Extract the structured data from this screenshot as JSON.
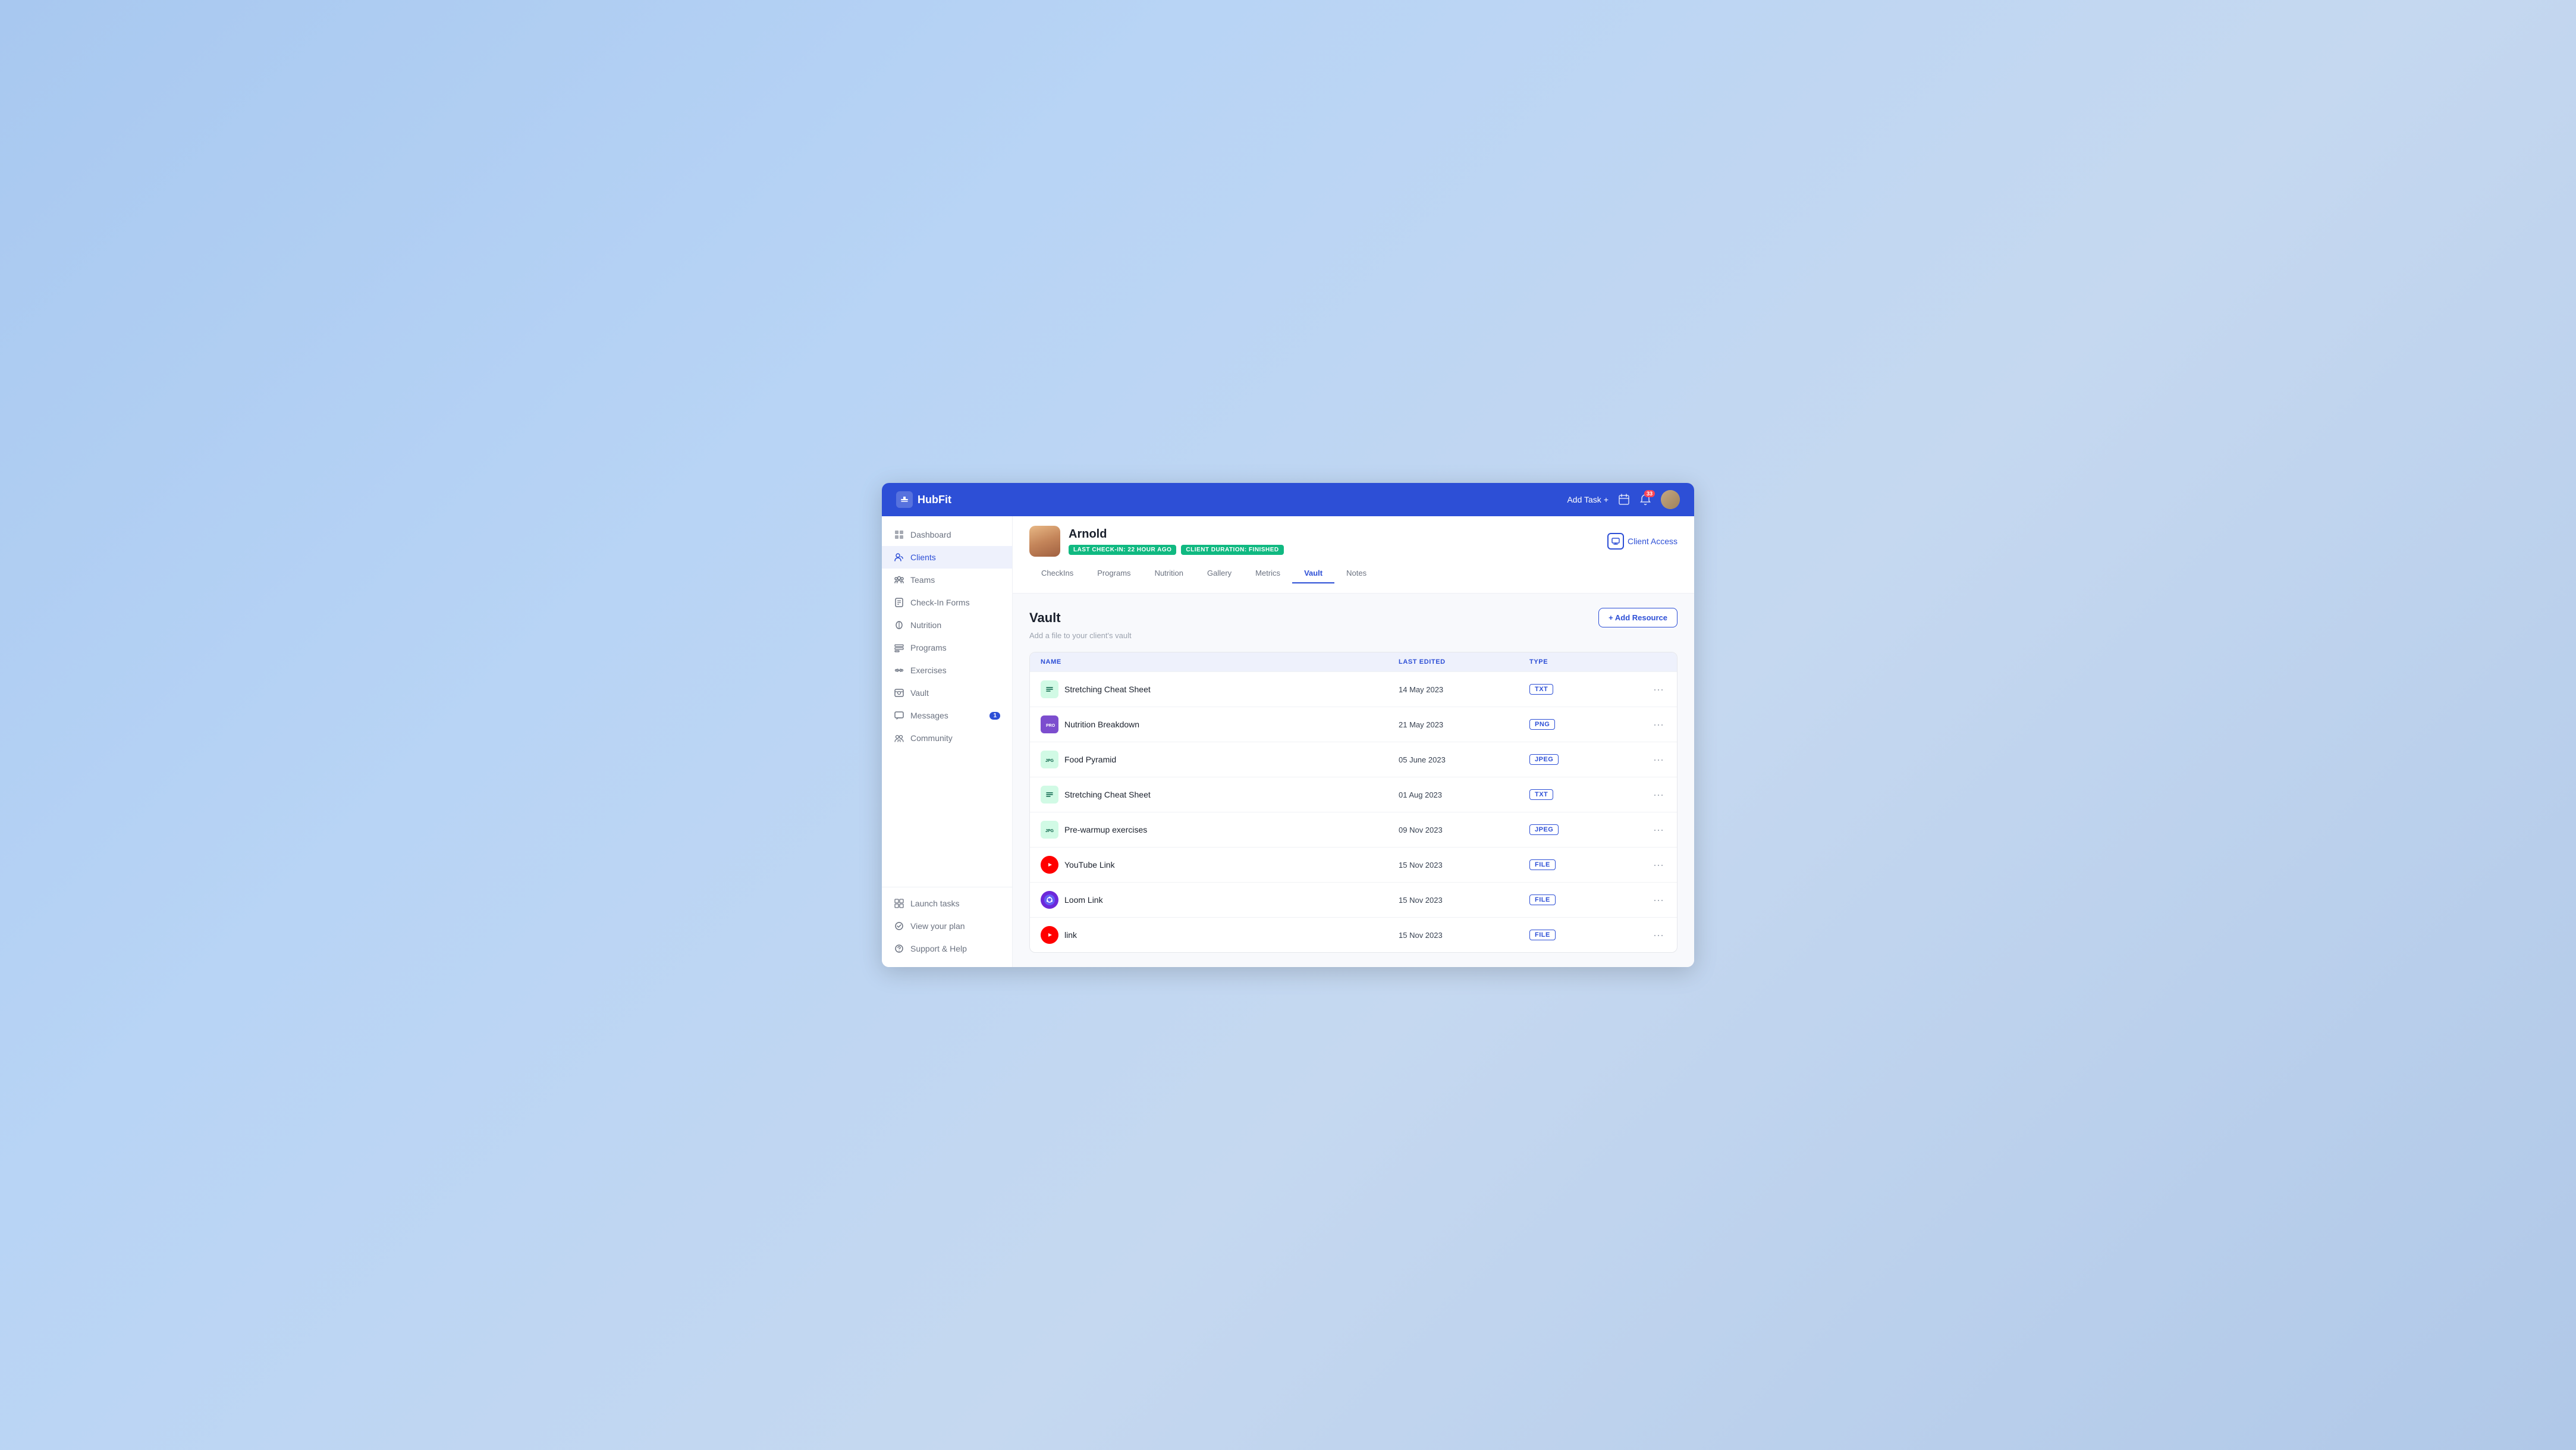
{
  "app": {
    "name": "HubFit",
    "logo_letter": "F"
  },
  "header": {
    "add_task_label": "Add Task",
    "add_task_plus": "+",
    "notification_count": "33"
  },
  "sidebar": {
    "items": [
      {
        "id": "dashboard",
        "label": "Dashboard",
        "active": false,
        "badge": null
      },
      {
        "id": "clients",
        "label": "Clients",
        "active": true,
        "badge": null
      },
      {
        "id": "teams",
        "label": "Teams",
        "active": false,
        "badge": null
      },
      {
        "id": "check-in-forms",
        "label": "Check-In Forms",
        "active": false,
        "badge": null
      },
      {
        "id": "nutrition",
        "label": "Nutrition",
        "active": false,
        "badge": null
      },
      {
        "id": "programs",
        "label": "Programs",
        "active": false,
        "badge": null
      },
      {
        "id": "exercises",
        "label": "Exercises",
        "active": false,
        "badge": null
      },
      {
        "id": "vault",
        "label": "Vault",
        "active": false,
        "badge": null
      },
      {
        "id": "messages",
        "label": "Messages",
        "active": false,
        "badge": "1"
      },
      {
        "id": "community",
        "label": "Community",
        "active": false,
        "badge": null
      }
    ],
    "bottom_items": [
      {
        "id": "launch-tasks",
        "label": "Launch tasks"
      },
      {
        "id": "view-your-plan",
        "label": "View your plan"
      },
      {
        "id": "support-help",
        "label": "Support & Help"
      }
    ]
  },
  "client": {
    "name": "Arnold",
    "checkin_badge": "LAST CHECK-IN: 22 HOUR AGO",
    "duration_badge": "CLIENT DURATION: FINISHED",
    "access_button_label": "Client Access"
  },
  "tabs": [
    {
      "id": "checkins",
      "label": "CheckIns",
      "active": false
    },
    {
      "id": "programs",
      "label": "Programs",
      "active": false
    },
    {
      "id": "nutrition",
      "label": "Nutrition",
      "active": false
    },
    {
      "id": "gallery",
      "label": "Gallery",
      "active": false
    },
    {
      "id": "metrics",
      "label": "Metrics",
      "active": false
    },
    {
      "id": "vault",
      "label": "Vault",
      "active": true
    },
    {
      "id": "notes",
      "label": "Notes",
      "active": false
    }
  ],
  "vault": {
    "title": "Vault",
    "subtitle": "Add a file to your client's vault",
    "add_resource_label": "+ Add Resource",
    "table": {
      "columns": [
        {
          "id": "name",
          "label": "NAME"
        },
        {
          "id": "last_edited",
          "label": "LAST EDITED"
        },
        {
          "id": "type",
          "label": "TYPE"
        }
      ],
      "rows": [
        {
          "id": "r1",
          "name": "Stretching Cheat Sheet",
          "last_edited": "14 May 2023",
          "type": "TXT",
          "icon_type": "txt"
        },
        {
          "id": "r2",
          "name": "Nutrition Breakdown",
          "last_edited": "21 May 2023",
          "type": "PNG",
          "icon_type": "png"
        },
        {
          "id": "r3",
          "name": "Food Pyramid",
          "last_edited": "05 June 2023",
          "type": "JPEG",
          "icon_type": "jpg"
        },
        {
          "id": "r4",
          "name": "Stretching Cheat Sheet",
          "last_edited": "01 Aug 2023",
          "type": "TXT",
          "icon_type": "txt"
        },
        {
          "id": "r5",
          "name": "Pre-warmup exercises",
          "last_edited": "09 Nov 2023",
          "type": "JPEG",
          "icon_type": "jpg"
        },
        {
          "id": "r6",
          "name": "YouTube Link",
          "last_edited": "15 Nov 2023",
          "type": "FILE",
          "icon_type": "yt"
        },
        {
          "id": "r7",
          "name": "Loom Link",
          "last_edited": "15 Nov 2023",
          "type": "FILE",
          "icon_type": "loom"
        },
        {
          "id": "r8",
          "name": "link",
          "last_edited": "15 Nov 2023",
          "type": "FILE",
          "icon_type": "link"
        }
      ]
    }
  }
}
